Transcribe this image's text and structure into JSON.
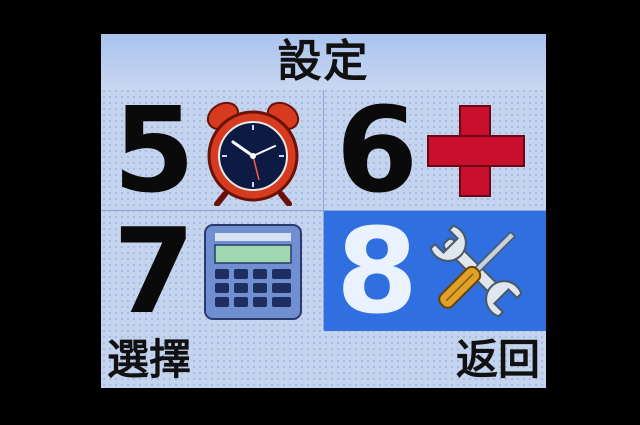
{
  "header": {
    "title": "設定"
  },
  "menu": {
    "items": [
      {
        "number": "5",
        "icon": "alarm-clock-icon"
      },
      {
        "number": "6",
        "icon": "red-cross-icon"
      },
      {
        "number": "7",
        "icon": "calculator-icon"
      },
      {
        "number": "8",
        "icon": "tools-icon",
        "selected": true
      }
    ]
  },
  "softkeys": {
    "left": "選擇",
    "right": "返回"
  },
  "colors": {
    "screen_bg": "#c4d4ef",
    "selected_bg": "#2f6fe0",
    "cross_red": "#c8102e"
  }
}
